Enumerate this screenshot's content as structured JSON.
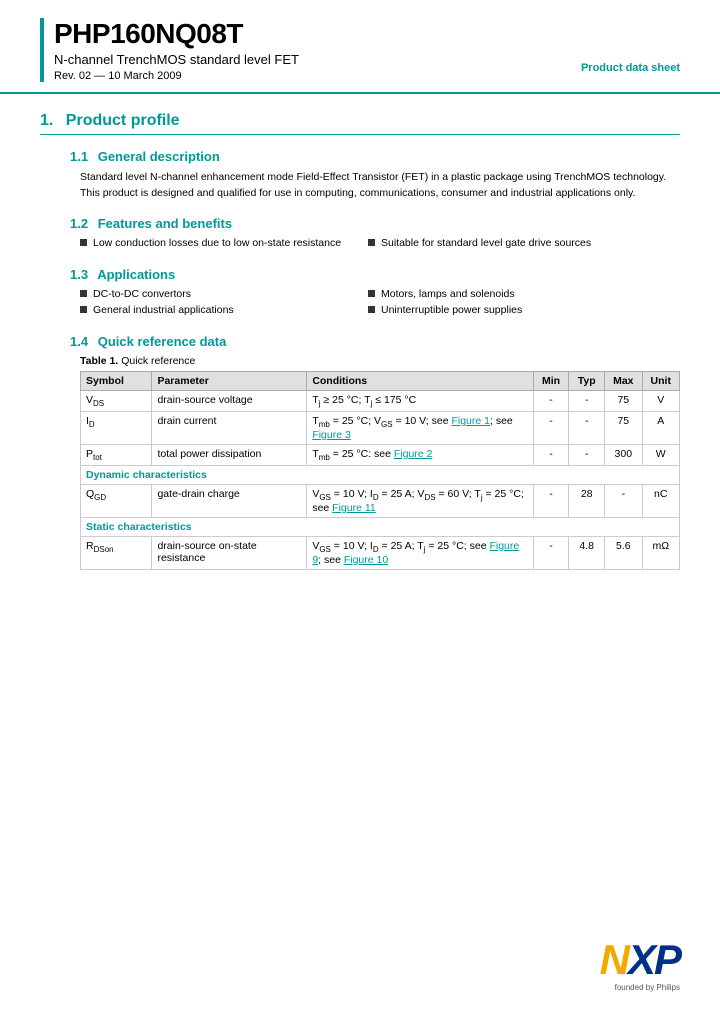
{
  "header": {
    "product_name": "PHP160NQ08T",
    "subtitle": "N-channel TrenchMOS standard level FET",
    "rev": "Rev. 02 — 10 March 2009",
    "label": "Product data sheet",
    "accent_bar_color": "#009999"
  },
  "section1": {
    "number": "1.",
    "title": "Product profile",
    "sub1": {
      "number": "1.1",
      "title": "General description",
      "text": "Standard level N-channel enhancement mode Field-Effect Transistor (FET) in a plastic package using TrenchMOS technology. This product is designed and qualified for use in computing, communications, consumer and industrial applications only."
    },
    "sub2": {
      "number": "1.2",
      "title": "Features and benefits",
      "features_left": [
        "Low conduction losses due to low on-state resistance"
      ],
      "features_right": [
        "Suitable for standard level gate drive sources"
      ]
    },
    "sub3": {
      "number": "1.3",
      "title": "Applications",
      "apps_left": [
        "DC-to-DC convertors",
        "General industrial applications"
      ],
      "apps_right": [
        "Motors, lamps and solenoids",
        "Uninterruptible power supplies"
      ]
    },
    "sub4": {
      "number": "1.4",
      "title": "Quick reference data",
      "table_caption_label": "Table 1.",
      "table_caption_text": "Quick reference",
      "table_headers": [
        "Symbol",
        "Parameter",
        "Conditions",
        "Min",
        "Typ",
        "Max",
        "Unit"
      ],
      "rows": [
        {
          "type": "data",
          "symbol": "V₂",
          "symbol_sub": "DS",
          "parameter": "drain-source voltage",
          "conditions": "Tⱼ ≥ 25 °C; Tⱼ ≤ 175 °C",
          "min": "-",
          "typ": "-",
          "max": "75",
          "unit": "V"
        },
        {
          "type": "data",
          "symbol": "I₂",
          "symbol_sub": "D",
          "parameter": "drain current",
          "conditions": "Tⱼ = 25 °C; V₂₂ = 10 V; see Figure 1; see Figure 3",
          "min": "-",
          "typ": "-",
          "max": "75",
          "unit": "A"
        },
        {
          "type": "data",
          "symbol": "P₂",
          "symbol_sub": "tot",
          "parameter": "total power dissipation",
          "conditions": "Tⱼ = 25 °C: see Figure 2",
          "min": "-",
          "typ": "-",
          "max": "300",
          "unit": "W"
        },
        {
          "type": "subheader",
          "label": "Dynamic characteristics"
        },
        {
          "type": "data",
          "symbol": "Q₂",
          "symbol_sub": "GD",
          "parameter": "gate-drain charge",
          "conditions": "V₂₂ = 10 V; I₂ = 25 A; V₂₂ = 60 V; Tⱼ = 25 °C; see Figure 11",
          "min": "-",
          "typ": "28",
          "max": "-",
          "unit": "nC"
        },
        {
          "type": "subheader",
          "label": "Static characteristics"
        },
        {
          "type": "data",
          "symbol": "R₂",
          "symbol_sub": "DSon",
          "parameter": "drain-source on-state resistance",
          "conditions": "V₂₂ = 10 V; I₂ = 25 A; Tⱼ = 25 °C; see Figure 9; see Figure 10",
          "min": "-",
          "typ": "4.8",
          "max": "5.6",
          "unit": "mΩ"
        }
      ]
    }
  },
  "footer": {
    "logo_n": "N",
    "logo_xp": "XP",
    "founded": "founded by Philips"
  }
}
